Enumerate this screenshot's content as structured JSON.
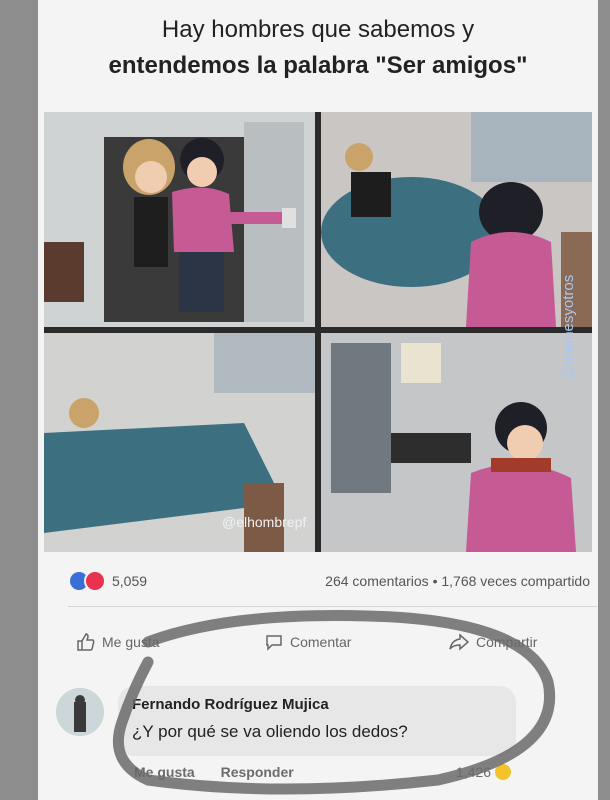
{
  "meme": {
    "title_line1": "Hay hombres que sabemos y",
    "title_line2": "entendemos la palabra \"Ser amigos\"",
    "comic_watermark": "@elhombrepf",
    "side_watermark": "@memesyotros"
  },
  "post_stats": {
    "reactions_count": "5,059",
    "comments_shares": "264 comentarios • 1,768 veces compartido"
  },
  "actions": {
    "like": "Me gusta",
    "comment": "Comentar",
    "share": "Compartir"
  },
  "comment": {
    "author": "Fernando Rodríguez Mujica",
    "text": "¿Y por qué se va oliendo los dedos?",
    "like_label": "Me gusta",
    "reply_label": "Responder",
    "reaction_count": "1,426"
  },
  "colors": {
    "like_reaction": "#3b6fd8",
    "love_reaction": "#e8324f",
    "haha_reaction": "#f4c22b",
    "annotation_stroke": "#6a6a6a"
  }
}
